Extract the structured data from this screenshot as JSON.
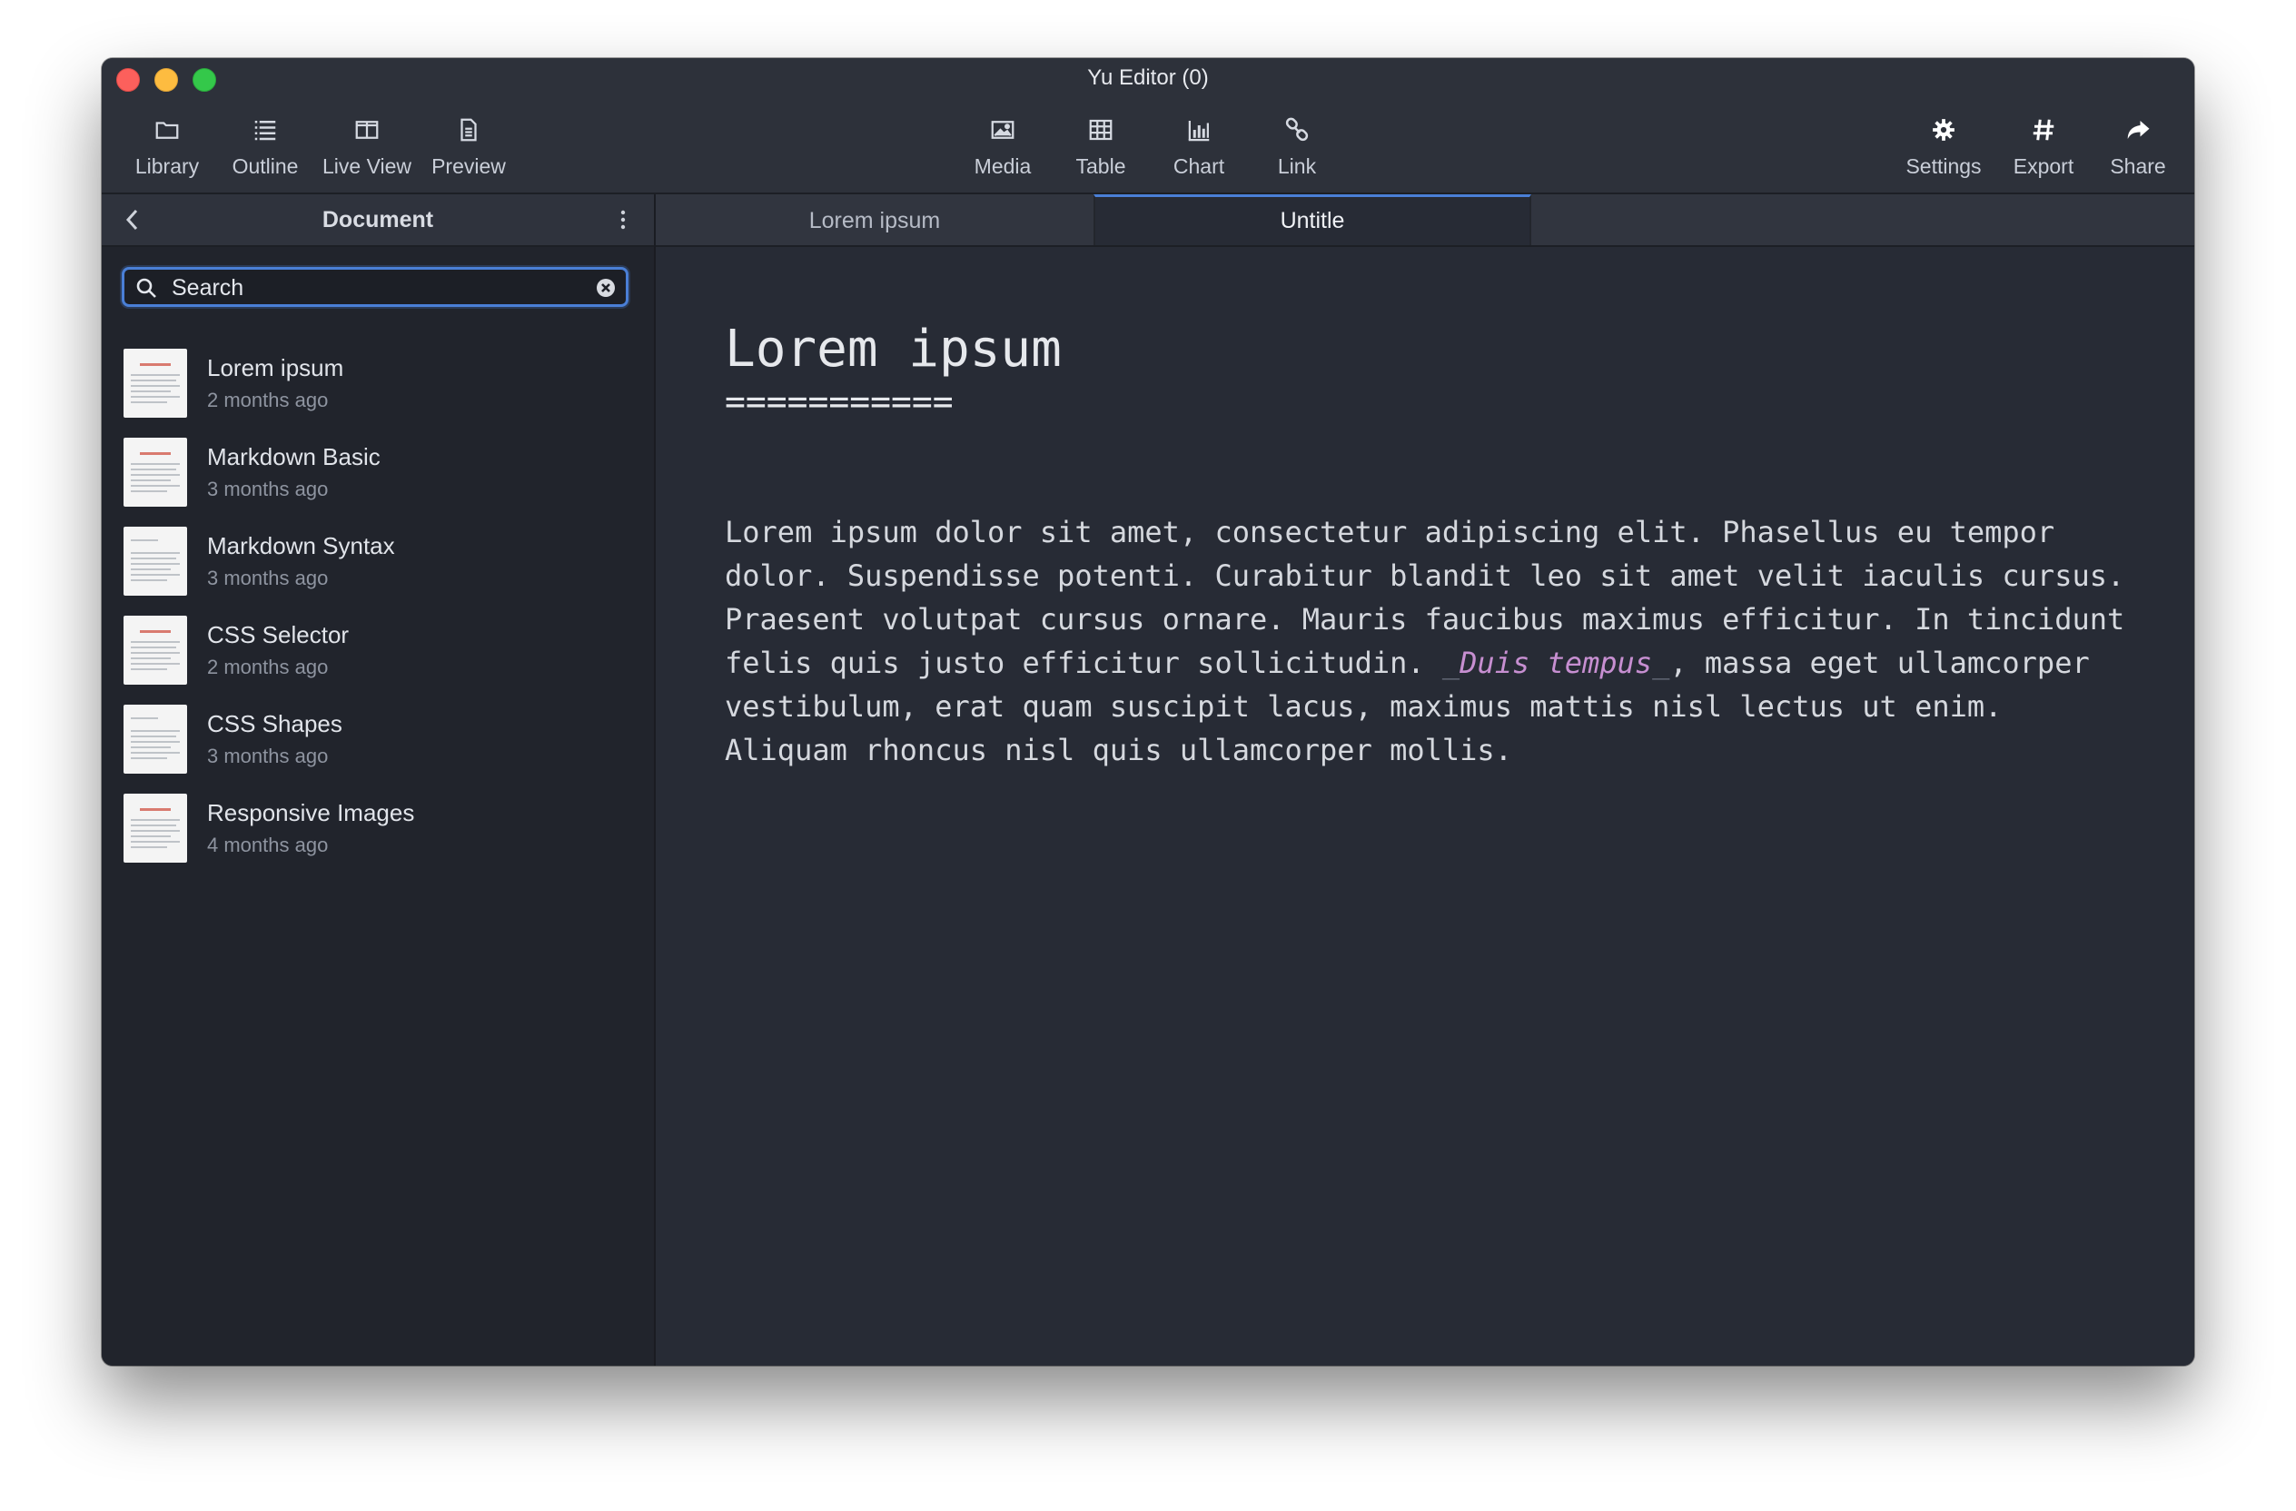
{
  "window": {
    "title": "Yu Editor (0)"
  },
  "toolbar": {
    "left": [
      {
        "label": "Library",
        "icon": "folder-icon"
      },
      {
        "label": "Outline",
        "icon": "list-icon"
      },
      {
        "label": "Live View",
        "icon": "columns-icon"
      },
      {
        "label": "Preview",
        "icon": "document-icon"
      }
    ],
    "center": [
      {
        "label": "Media",
        "icon": "image-icon"
      },
      {
        "label": "Table",
        "icon": "table-icon"
      },
      {
        "label": "Chart",
        "icon": "bar-chart-icon"
      },
      {
        "label": "Link",
        "icon": "link-icon"
      }
    ],
    "right": [
      {
        "label": "Settings",
        "icon": "gear-icon"
      },
      {
        "label": "Export",
        "icon": "hash-icon"
      },
      {
        "label": "Share",
        "icon": "share-arrow-icon"
      }
    ]
  },
  "sidebar": {
    "title": "Document",
    "search": {
      "placeholder": "Search",
      "value": ""
    },
    "documents": [
      {
        "name": "Lorem ipsum",
        "date": "2 months ago"
      },
      {
        "name": "Markdown Basic",
        "date": "3 months ago"
      },
      {
        "name": "Markdown Syntax",
        "date": "3 months ago"
      },
      {
        "name": "CSS Selector",
        "date": "2 months ago"
      },
      {
        "name": "CSS Shapes",
        "date": "3 months ago"
      },
      {
        "name": "Responsive Images",
        "date": "4 months ago"
      }
    ]
  },
  "tabs": [
    {
      "label": "Lorem ipsum",
      "active": false
    },
    {
      "label": "Untitle",
      "active": true
    }
  ],
  "editor": {
    "title": "Lorem ipsum",
    "underline": "===========",
    "body_lines": [
      "Lorem ipsum dolor sit amet, consectetur adipiscing elit. Phasellus eu tempor",
      "dolor. Suspendisse potenti. Curabitur blandit leo sit amet velit iaculis cursus.",
      "Praesent volutpat cursus ornare. Mauris faucibus maximus efficitur. In tincidunt"
    ],
    "line4_before": "felis quis justo efficitur sollicitudin. ",
    "line4_em_open": "_",
    "line4_em": "Duis tempus",
    "line4_em_close": "_",
    "line4_after": ", massa eget ullamcorper",
    "body_lines_end": [
      "vestibulum, erat quam suscipit lacus, maximus mattis nisl lectus ut enim.",
      "Aliquam rhoncus nisl quis ullamcorper mollis."
    ]
  },
  "colors": {
    "accent": "#4a7fd6",
    "emphasis": "#c78fd1",
    "editor_bg": "#272b35",
    "sidebar_bg": "#21242c"
  }
}
